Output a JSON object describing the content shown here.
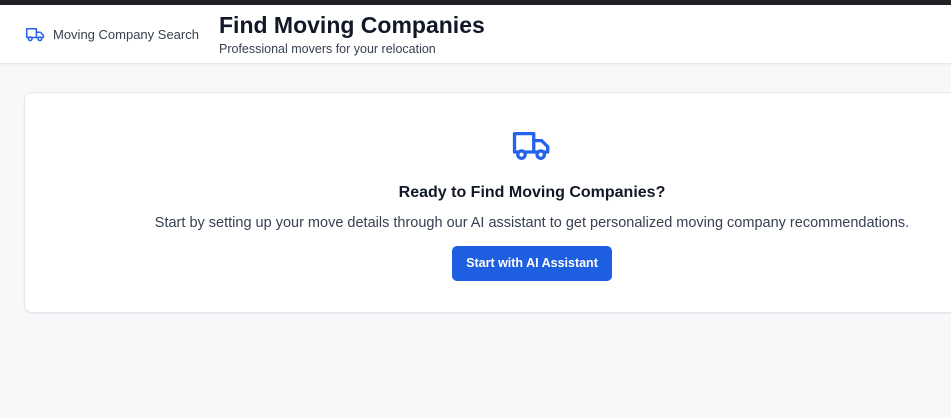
{
  "header": {
    "brand_label": "Moving Company Search",
    "brand_icon": "truck-icon",
    "title": "Find Moving Companies",
    "subtitle": "Professional movers for your relocation"
  },
  "empty_state": {
    "icon": "truck-icon",
    "heading": "Ready to Find Moving Companies?",
    "description": "Start by setting up your move details through our AI assistant to get personalized moving company recommendations.",
    "cta_label": "Start with AI Assistant"
  },
  "colors": {
    "accent": "#1d5fe0",
    "page_background": "#f7f8fa",
    "top_strip": "#1f2125"
  }
}
